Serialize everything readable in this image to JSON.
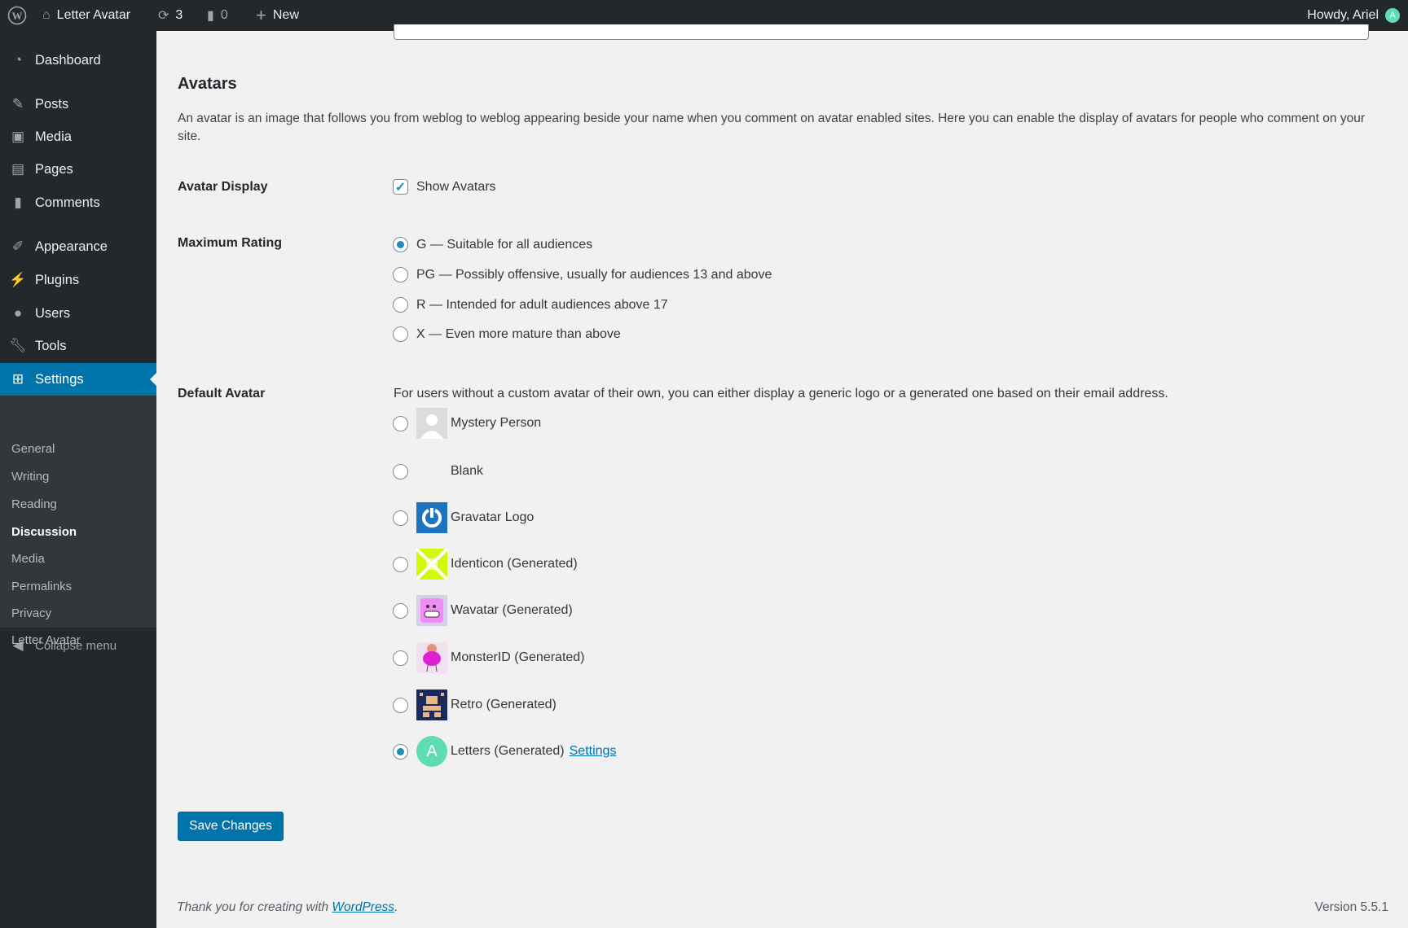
{
  "adminbar": {
    "site": "Letter Avatar",
    "updates": "3",
    "comments": "0",
    "new": "New",
    "howdy": "Howdy, Ariel",
    "avatar_letter": "A"
  },
  "menu": [
    {
      "label": "Dashboard",
      "icon": "dashboard-icon"
    },
    {
      "label": "Posts",
      "icon": "pin-icon"
    },
    {
      "label": "Media",
      "icon": "media-icon"
    },
    {
      "label": "Pages",
      "icon": "pages-icon"
    },
    {
      "label": "Comments",
      "icon": "comment-icon"
    },
    {
      "label": "Appearance",
      "icon": "brush-icon"
    },
    {
      "label": "Plugins",
      "icon": "plugin-icon"
    },
    {
      "label": "Users",
      "icon": "user-icon"
    },
    {
      "label": "Tools",
      "icon": "wrench-icon"
    },
    {
      "label": "Settings",
      "icon": "settings-icon"
    }
  ],
  "submenu": [
    "General",
    "Writing",
    "Reading",
    "Discussion",
    "Media",
    "Permalinks",
    "Privacy",
    "Letter Avatar"
  ],
  "collapse": "Collapse menu",
  "section": {
    "title": "Avatars",
    "description": "An avatar is an image that follows you from weblog to weblog appearing beside your name when you comment on avatar enabled sites. Here you can enable the display of avatars for people who comment on your site."
  },
  "avatar_display": {
    "label": "Avatar Display",
    "checkbox": "Show Avatars",
    "checked": true
  },
  "rating": {
    "label": "Maximum Rating",
    "options": [
      "G — Suitable for all audiences",
      "PG — Possibly offensive, usually for audiences 13 and above",
      "R — Intended for adult audiences above 17",
      "X — Even more mature than above"
    ],
    "selected": 0
  },
  "default_avatar": {
    "label": "Default Avatar",
    "description": "For users without a custom avatar of their own, you can either display a generic logo or a generated one based on their email address.",
    "options": [
      "Mystery Person",
      "Blank",
      "Gravatar Logo",
      "Identicon (Generated)",
      "Wavatar (Generated)",
      "MonsterID (Generated)",
      "Retro (Generated)",
      "Letters (Generated)"
    ],
    "settings_link": "Settings",
    "letter": "A",
    "selected": 7
  },
  "save": "Save Changes",
  "footer": {
    "thanks": "Thank you for creating with ",
    "link": "WordPress",
    "period": ".",
    "version": "Version 5.5.1"
  },
  "colors": {
    "accent": "#0073aa",
    "letter_avatar": "#5fdcb2"
  }
}
